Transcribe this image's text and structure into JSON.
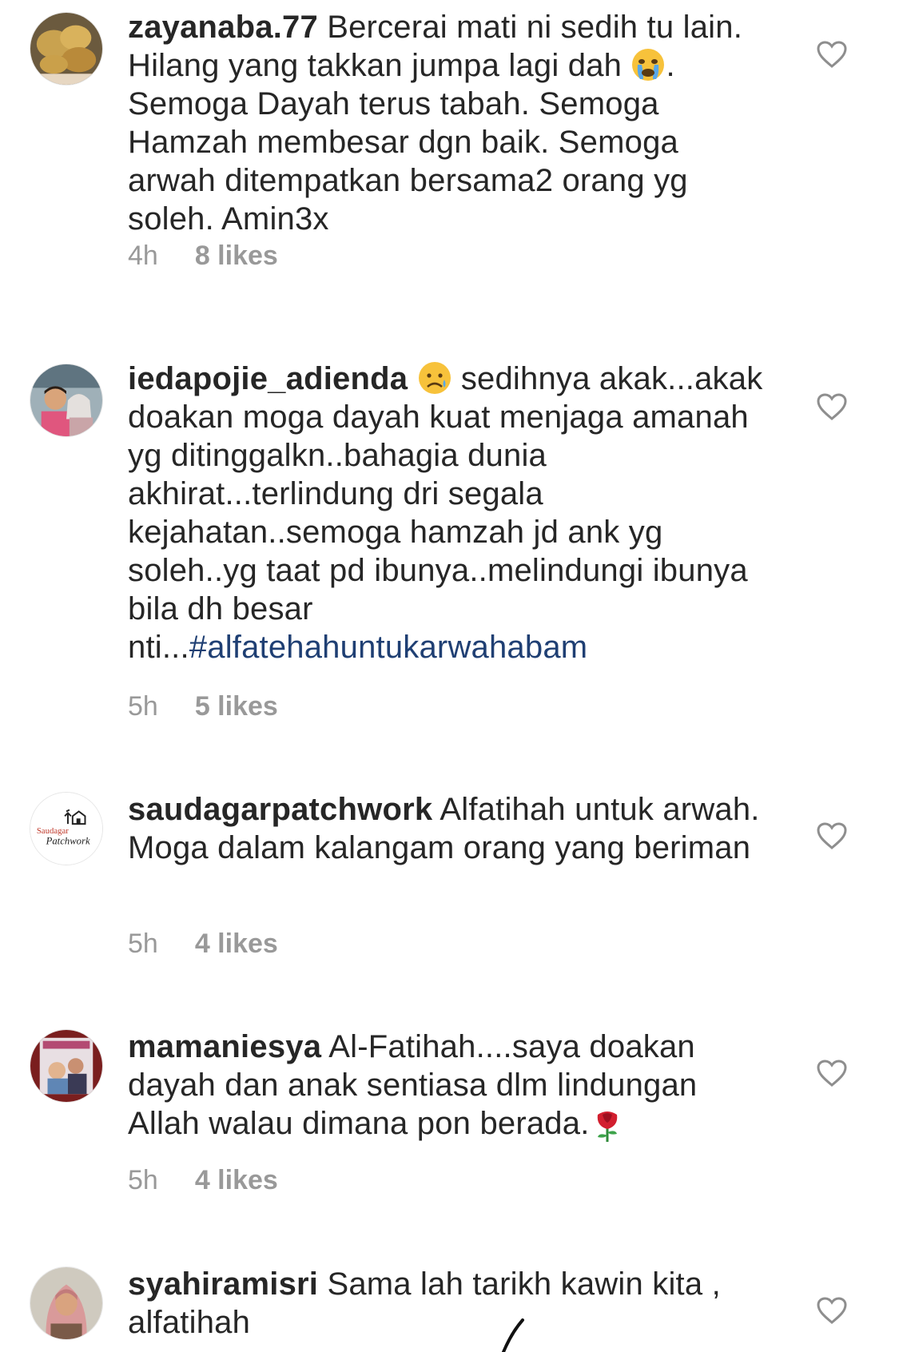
{
  "comments": [
    {
      "username": "zayanaba.77",
      "text_before_emoji": "Bercerai mati ni sedih tu lain. Hilang yang takkan jumpa lagi dah",
      "emoji": "crying-face",
      "text_after_emoji": ". Semoga Dayah terus tabah. Semoga Hamzah membesar dgn baik. Semoga arwah ditempatkan bersama2 orang yg soleh. Amin3x",
      "time": "4h",
      "likes": "8 likes"
    },
    {
      "username": "iedapojie_adienda",
      "emoji": "sad-face",
      "text_after_emoji": "sedihnya akak...akak doakan moga dayah kuat menjaga amanah yg ditinggalkn..bahagia dunia akhirat...terlindung dri segala kejahatan..semoga hamzah jd ank yg soleh..yg taat pd ibunya..melindungi ibunya bila dh besar nti...",
      "hashtag": "#alfatehahuntukarwahabam",
      "time": "5h",
      "likes": "5 likes"
    },
    {
      "username": "saudagarpatchwork",
      "text": "Alfatihah untuk arwah. Moga dalam kalangam orang yang beriman",
      "avatar_text_1": "Saudagar",
      "avatar_text_2": "Patchwork",
      "time": "5h",
      "likes": "4 likes"
    },
    {
      "username": "mamaniesya",
      "text": "Al-Fatihah....saya doakan dayah dan anak sentiasa dlm lindungan Allah walau dimana pon berada.",
      "emoji": "rose",
      "time": "5h",
      "likes": "4 likes"
    },
    {
      "username": "syahiramisri",
      "text": "Sama lah tarikh kawin kita , alfatihah"
    }
  ],
  "icons": {
    "like": "heart-outline-icon"
  },
  "colors": {
    "text": "#262626",
    "meta": "#999999",
    "hashtag": "#1f3f73"
  }
}
